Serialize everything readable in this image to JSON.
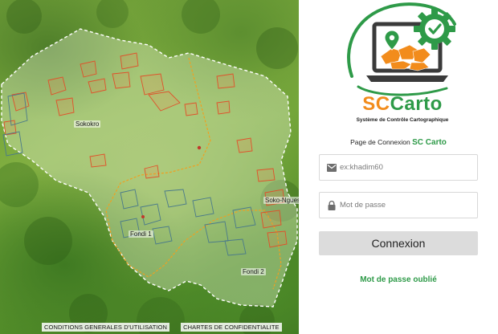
{
  "map": {
    "labels": {
      "sokokro": "Sokokro",
      "sokonguesse": "Soko-Nguesse",
      "fondi1": "Fondi 1",
      "fondi2": "Fondi 2"
    },
    "footer": {
      "conditions": "CONDITIONS GENERALES D'UTILISATION",
      "charter": "CHARTES DE CONFIDENTIALITE"
    }
  },
  "brand": {
    "name_part1": "SC",
    "name_part2": "Carto",
    "subtitle": "Système de Contrôle Cartographique",
    "colors": {
      "orange": "#f28c1c",
      "green": "#2e9a48",
      "dark": "#3a3a3a"
    }
  },
  "login": {
    "heading_prefix": "Page de Connexion",
    "heading_highlight": "SC Carto",
    "username_placeholder": "ex:khadim60",
    "password_placeholder": "Mot de passe",
    "submit_label": "Connexion",
    "forgot_label": "Mot de passe oublié",
    "icons": {
      "username": "envelope-icon",
      "password": "lock-icon"
    }
  }
}
